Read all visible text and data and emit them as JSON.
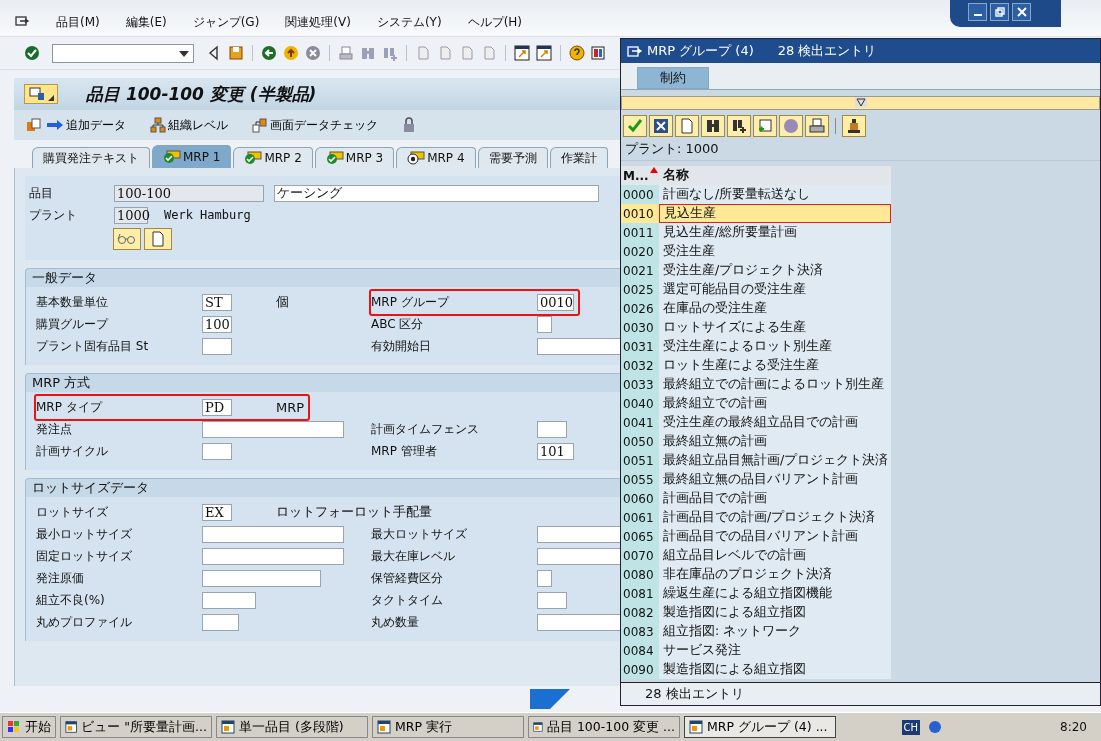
{
  "menu": [
    {
      "label": "品目(M)"
    },
    {
      "label": "編集(E)"
    },
    {
      "label": "ジャンプ(G)"
    },
    {
      "label": "関連処理(V)"
    },
    {
      "label": "システム(Y)"
    },
    {
      "label": "ヘルプ(H)"
    }
  ],
  "screen_title": "品目 100-100 変更 (半製品)",
  "app_toolbar": [
    {
      "label": "追加データ",
      "kind": "arrow"
    },
    {
      "label": "組織レベル",
      "kind": "org"
    },
    {
      "label": "画面データチェック",
      "kind": "check"
    },
    {
      "kind": "lock"
    }
  ],
  "tabs": [
    {
      "label": "購買発注テキスト",
      "kind": "plain",
      "selected": false
    },
    {
      "label": "MRP 1",
      "kind": "done",
      "selected": true
    },
    {
      "label": "MRP 2",
      "kind": "done",
      "selected": false
    },
    {
      "label": "MRP 3",
      "kind": "done",
      "selected": false
    },
    {
      "label": "MRP 4",
      "kind": "open",
      "selected": false
    },
    {
      "label": "需要予測",
      "kind": "plain",
      "selected": false
    },
    {
      "label": "作業計",
      "kind": "plain",
      "selected": false
    }
  ],
  "header": {
    "item_label": "品目",
    "item_value": "100-100",
    "description": "ケーシング",
    "plant_label": "プラント",
    "plant_value": "1000",
    "plant_name": "Werk Hamburg"
  },
  "sections": [
    {
      "title": "一般データ",
      "rows": [
        {
          "left": {
            "label": "基本数量単位",
            "value": "ST",
            "highlighted": false
          },
          "note": "個",
          "right": {
            "label": "MRP グループ",
            "value": "0010",
            "highlighted": true
          }
        },
        {
          "left": {
            "label": "購買グループ",
            "value": "100",
            "highlighted": false
          },
          "right": {
            "label": "ABC 区分",
            "highlighted": false
          }
        },
        {
          "left": {
            "label": "プラント固有品目 St",
            "highlighted": false
          },
          "right": {
            "label": "有効開始日",
            "highlighted": false
          }
        }
      ]
    },
    {
      "title": "MRP 方式",
      "rows": [
        {
          "left": {
            "label": "MRP タイプ",
            "value": "PD",
            "highlighted": true
          },
          "note": "MRP"
        },
        {
          "left": {
            "label": "発注点",
            "highlighted": false
          },
          "right": {
            "label": "計画タイムフェンス",
            "highlighted": false
          }
        },
        {
          "left": {
            "label": "計画サイクル",
            "highlighted": false
          },
          "right": {
            "label": "MRP 管理者",
            "value": "101",
            "highlighted": false
          }
        }
      ]
    },
    {
      "title": "ロットサイズデータ",
      "rows": [
        {
          "left": {
            "label": "ロットサイズ",
            "value": "EX",
            "highlighted": false
          },
          "note": "ロットフォーロット手配量"
        },
        {
          "left": {
            "label": "最小ロットサイズ",
            "highlighted": false
          },
          "right": {
            "label": "最大ロットサイズ",
            "highlighted": false
          }
        },
        {
          "left": {
            "label": "固定ロットサイズ",
            "highlighted": false
          },
          "right": {
            "label": "最大在庫レベル",
            "highlighted": false
          }
        },
        {
          "left": {
            "label": "発注原価",
            "highlighted": false
          },
          "right": {
            "label": "保管経費区分",
            "highlighted": false
          }
        },
        {
          "left": {
            "label": "組立不良(%)",
            "highlighted": false
          },
          "right": {
            "label": "タクトタイム",
            "highlighted": false
          }
        },
        {
          "left": {
            "label": "丸めプロファイル",
            "highlighted": false
          },
          "right": {
            "label": "丸め数量",
            "highlighted": false
          }
        }
      ]
    }
  ],
  "popup": {
    "title": "MRP グループ (4)",
    "count": "28 検出エントリ",
    "tabs": [
      {
        "label": "制約",
        "selected": true
      }
    ],
    "plant": "プラント: 1000",
    "columns": [
      "M...",
      "名称"
    ],
    "rows": [
      {
        "code": "0000",
        "name": "計画なし/所要量転送なし",
        "selected": false
      },
      {
        "code": "0010",
        "name": "見込生産",
        "selected": true
      },
      {
        "code": "0011",
        "name": "見込生産/総所要量計画",
        "selected": false
      },
      {
        "code": "0020",
        "name": "受注生産",
        "selected": false
      },
      {
        "code": "0021",
        "name": "受注生産/プロジェクト決済",
        "selected": false
      },
      {
        "code": "0025",
        "name": "選定可能品目の受注生産",
        "selected": false
      },
      {
        "code": "0026",
        "name": "在庫品の受注生産",
        "selected": false
      },
      {
        "code": "0030",
        "name": "ロットサイズによる生産",
        "selected": false
      },
      {
        "code": "0031",
        "name": "受注生産によるロット別生産",
        "selected": false
      },
      {
        "code": "0032",
        "name": "ロット生産による受注生産",
        "selected": false
      },
      {
        "code": "0033",
        "name": "最終組立での計画によるロット別生産",
        "selected": false
      },
      {
        "code": "0040",
        "name": "最終組立での計画",
        "selected": false
      },
      {
        "code": "0041",
        "name": "受注生産の最終組立品目での計画",
        "selected": false
      },
      {
        "code": "0050",
        "name": "最終組立無の計画",
        "selected": false
      },
      {
        "code": "0051",
        "name": "最終組立品目無計画/プロジェクト決済",
        "selected": false
      },
      {
        "code": "0055",
        "name": "最終組立無の品目バリアント計画",
        "selected": false
      },
      {
        "code": "0060",
        "name": "計画品目での計画",
        "selected": false
      },
      {
        "code": "0061",
        "name": "計画品目での計画/プロジェクト決済",
        "selected": false
      },
      {
        "code": "0065",
        "name": "計画品目での品目バリアント計画",
        "selected": false
      },
      {
        "code": "0070",
        "name": "組立品目レベルでの計画",
        "selected": false
      },
      {
        "code": "0080",
        "name": "非在庫品のプロジェクト決済",
        "selected": false
      },
      {
        "code": "0081",
        "name": "繰返生産による組立指図機能",
        "selected": false
      },
      {
        "code": "0082",
        "name": "製造指図による組立指図",
        "selected": false
      },
      {
        "code": "0083",
        "name": "組立指図: ネットワーク",
        "selected": false
      },
      {
        "code": "0084",
        "name": "サービス発注",
        "selected": false
      },
      {
        "code": "0090",
        "name": "製造指図による組立指図",
        "selected": false
      }
    ],
    "status": "28 検出エントリ"
  },
  "taskbar": {
    "start": "开始",
    "items": [
      {
        "label": "ビュー \"所要量計画...",
        "selected": false
      },
      {
        "label": "単一品目 (多段階)",
        "selected": false
      },
      {
        "label": "MRP 実行",
        "selected": false
      },
      {
        "label": "品目 100-100 変更 ...",
        "selected": false
      },
      {
        "label": "MRP グループ (4) ...",
        "selected": true
      }
    ],
    "language": "CH",
    "clock": "8:20"
  }
}
